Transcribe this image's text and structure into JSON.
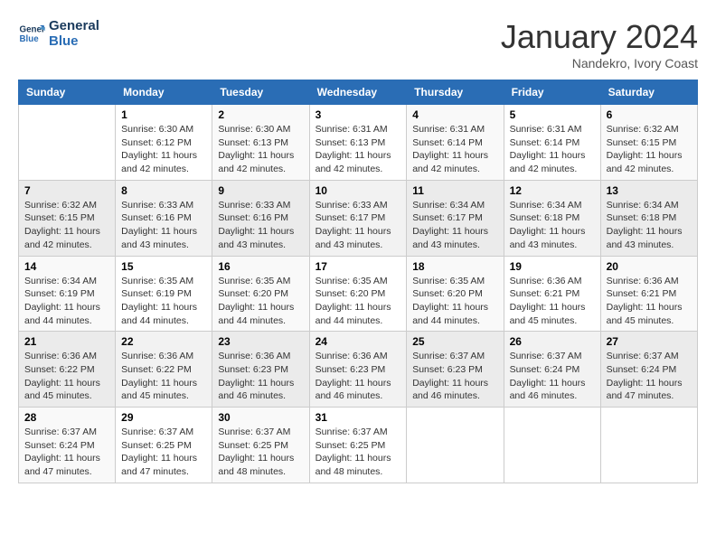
{
  "logo": {
    "line1": "General",
    "line2": "Blue"
  },
  "title": "January 2024",
  "subtitle": "Nandekro, Ivory Coast",
  "days_header": [
    "Sunday",
    "Monday",
    "Tuesday",
    "Wednesday",
    "Thursday",
    "Friday",
    "Saturday"
  ],
  "weeks": [
    [
      {
        "num": "",
        "info": ""
      },
      {
        "num": "1",
        "info": "Sunrise: 6:30 AM\nSunset: 6:12 PM\nDaylight: 11 hours\nand 42 minutes."
      },
      {
        "num": "2",
        "info": "Sunrise: 6:30 AM\nSunset: 6:13 PM\nDaylight: 11 hours\nand 42 minutes."
      },
      {
        "num": "3",
        "info": "Sunrise: 6:31 AM\nSunset: 6:13 PM\nDaylight: 11 hours\nand 42 minutes."
      },
      {
        "num": "4",
        "info": "Sunrise: 6:31 AM\nSunset: 6:14 PM\nDaylight: 11 hours\nand 42 minutes."
      },
      {
        "num": "5",
        "info": "Sunrise: 6:31 AM\nSunset: 6:14 PM\nDaylight: 11 hours\nand 42 minutes."
      },
      {
        "num": "6",
        "info": "Sunrise: 6:32 AM\nSunset: 6:15 PM\nDaylight: 11 hours\nand 42 minutes."
      }
    ],
    [
      {
        "num": "7",
        "info": "Sunrise: 6:32 AM\nSunset: 6:15 PM\nDaylight: 11 hours\nand 42 minutes."
      },
      {
        "num": "8",
        "info": "Sunrise: 6:33 AM\nSunset: 6:16 PM\nDaylight: 11 hours\nand 43 minutes."
      },
      {
        "num": "9",
        "info": "Sunrise: 6:33 AM\nSunset: 6:16 PM\nDaylight: 11 hours\nand 43 minutes."
      },
      {
        "num": "10",
        "info": "Sunrise: 6:33 AM\nSunset: 6:17 PM\nDaylight: 11 hours\nand 43 minutes."
      },
      {
        "num": "11",
        "info": "Sunrise: 6:34 AM\nSunset: 6:17 PM\nDaylight: 11 hours\nand 43 minutes."
      },
      {
        "num": "12",
        "info": "Sunrise: 6:34 AM\nSunset: 6:18 PM\nDaylight: 11 hours\nand 43 minutes."
      },
      {
        "num": "13",
        "info": "Sunrise: 6:34 AM\nSunset: 6:18 PM\nDaylight: 11 hours\nand 43 minutes."
      }
    ],
    [
      {
        "num": "14",
        "info": "Sunrise: 6:34 AM\nSunset: 6:19 PM\nDaylight: 11 hours\nand 44 minutes."
      },
      {
        "num": "15",
        "info": "Sunrise: 6:35 AM\nSunset: 6:19 PM\nDaylight: 11 hours\nand 44 minutes."
      },
      {
        "num": "16",
        "info": "Sunrise: 6:35 AM\nSunset: 6:20 PM\nDaylight: 11 hours\nand 44 minutes."
      },
      {
        "num": "17",
        "info": "Sunrise: 6:35 AM\nSunset: 6:20 PM\nDaylight: 11 hours\nand 44 minutes."
      },
      {
        "num": "18",
        "info": "Sunrise: 6:35 AM\nSunset: 6:20 PM\nDaylight: 11 hours\nand 44 minutes."
      },
      {
        "num": "19",
        "info": "Sunrise: 6:36 AM\nSunset: 6:21 PM\nDaylight: 11 hours\nand 45 minutes."
      },
      {
        "num": "20",
        "info": "Sunrise: 6:36 AM\nSunset: 6:21 PM\nDaylight: 11 hours\nand 45 minutes."
      }
    ],
    [
      {
        "num": "21",
        "info": "Sunrise: 6:36 AM\nSunset: 6:22 PM\nDaylight: 11 hours\nand 45 minutes."
      },
      {
        "num": "22",
        "info": "Sunrise: 6:36 AM\nSunset: 6:22 PM\nDaylight: 11 hours\nand 45 minutes."
      },
      {
        "num": "23",
        "info": "Sunrise: 6:36 AM\nSunset: 6:23 PM\nDaylight: 11 hours\nand 46 minutes."
      },
      {
        "num": "24",
        "info": "Sunrise: 6:36 AM\nSunset: 6:23 PM\nDaylight: 11 hours\nand 46 minutes."
      },
      {
        "num": "25",
        "info": "Sunrise: 6:37 AM\nSunset: 6:23 PM\nDaylight: 11 hours\nand 46 minutes."
      },
      {
        "num": "26",
        "info": "Sunrise: 6:37 AM\nSunset: 6:24 PM\nDaylight: 11 hours\nand 46 minutes."
      },
      {
        "num": "27",
        "info": "Sunrise: 6:37 AM\nSunset: 6:24 PM\nDaylight: 11 hours\nand 47 minutes."
      }
    ],
    [
      {
        "num": "28",
        "info": "Sunrise: 6:37 AM\nSunset: 6:24 PM\nDaylight: 11 hours\nand 47 minutes."
      },
      {
        "num": "29",
        "info": "Sunrise: 6:37 AM\nSunset: 6:25 PM\nDaylight: 11 hours\nand 47 minutes."
      },
      {
        "num": "30",
        "info": "Sunrise: 6:37 AM\nSunset: 6:25 PM\nDaylight: 11 hours\nand 48 minutes."
      },
      {
        "num": "31",
        "info": "Sunrise: 6:37 AM\nSunset: 6:25 PM\nDaylight: 11 hours\nand 48 minutes."
      },
      {
        "num": "",
        "info": ""
      },
      {
        "num": "",
        "info": ""
      },
      {
        "num": "",
        "info": ""
      }
    ]
  ]
}
